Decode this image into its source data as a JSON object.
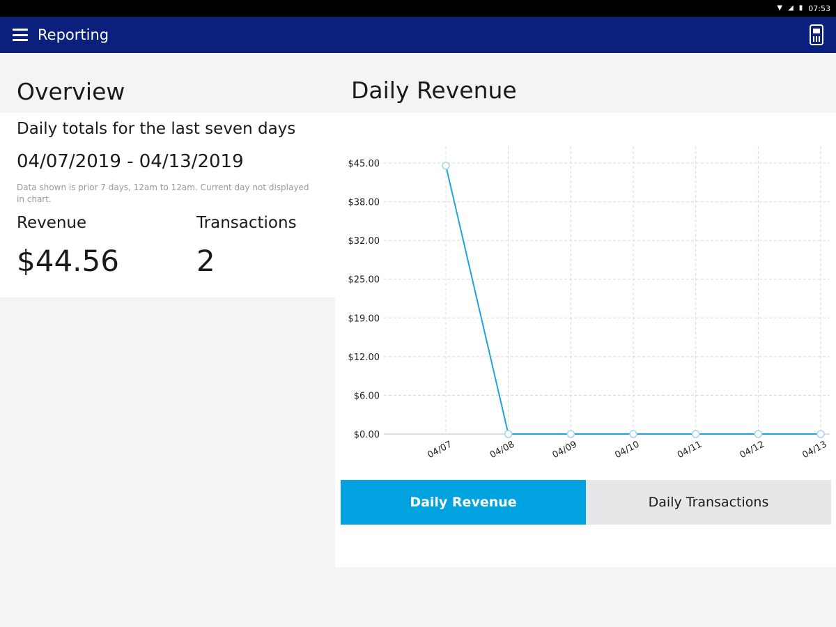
{
  "status_bar": {
    "time": "07:53",
    "icons": [
      "wifi-icon",
      "signal-icon",
      "battery-icon"
    ]
  },
  "app_bar": {
    "title": "Reporting",
    "menu_icon": "hamburger-menu-icon",
    "terminal_icon": "card-terminal-icon"
  },
  "overview": {
    "heading": "Overview",
    "subtitle": "Daily totals for the last seven days",
    "date_range": "04/07/2019 - 04/13/2019",
    "note": "Data shown is prior 7 days, 12am to 12am. Current day not displayed in chart.",
    "revenue_label": "Revenue",
    "revenue_value": "$44.56",
    "transactions_label": "Transactions",
    "transactions_value": "2"
  },
  "revenue_panel": {
    "heading": "Daily Revenue",
    "tabs": [
      {
        "label": "Daily Revenue",
        "active": true
      },
      {
        "label": "Daily Transactions",
        "active": false
      }
    ]
  },
  "colors": {
    "app_bar": "#0b1f7d",
    "accent": "#00a3e0",
    "line": "#1fa3dc",
    "background": "#f3f4f6"
  },
  "chart_data": {
    "type": "line",
    "categories": [
      "04/07",
      "04/08",
      "04/09",
      "04/10",
      "04/11",
      "04/12",
      "04/13"
    ],
    "values": [
      44.56,
      0,
      0,
      0,
      0,
      0,
      0
    ],
    "yticks": [
      "$0.00",
      "$6.00",
      "$12.00",
      "$19.00",
      "$25.00",
      "$32.00",
      "$38.00",
      "$45.00"
    ],
    "ylim": [
      0,
      45
    ],
    "grid": true
  }
}
